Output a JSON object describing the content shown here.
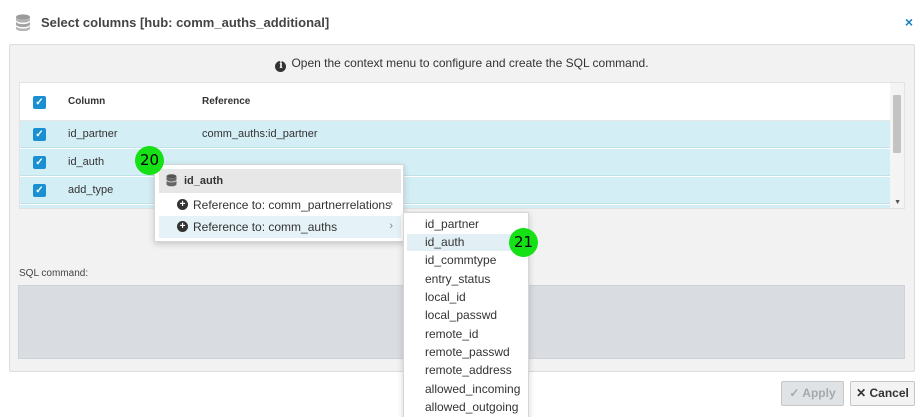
{
  "dialog": {
    "title": "Select columns [hub: comm_auths_additional]",
    "close_label": "×"
  },
  "info": {
    "icon": "info-icon",
    "text": "Open the context menu to configure and create the SQL command."
  },
  "grid": {
    "headers": {
      "column": "Column",
      "reference": "Reference"
    },
    "rows": [
      {
        "column": "id_partner",
        "reference": "comm_auths:id_partner",
        "checked": true
      },
      {
        "column": "id_auth",
        "reference": "",
        "checked": true
      },
      {
        "column": "add_type",
        "reference": "",
        "checked": true
      }
    ]
  },
  "context_menu": {
    "header": "id_auth",
    "items": [
      {
        "label": "Reference to: comm_partnerrelations"
      },
      {
        "label": "Reference to: comm_auths"
      }
    ]
  },
  "submenu": {
    "items": [
      "id_partner",
      "id_auth",
      "id_commtype",
      "entry_status",
      "local_id",
      "local_passwd",
      "remote_id",
      "remote_passwd",
      "remote_address",
      "allowed_incoming",
      "allowed_outgoing"
    ],
    "highlighted_index": 1
  },
  "sql": {
    "label": "SQL command:",
    "value": ""
  },
  "buttons": {
    "apply": "Apply",
    "cancel": "Cancel"
  },
  "annotations": {
    "badge_20": "20",
    "badge_21": "21"
  },
  "colors": {
    "accent": "#1a8fd1",
    "row_selected": "#d4eef5",
    "badge": "#16e016"
  }
}
